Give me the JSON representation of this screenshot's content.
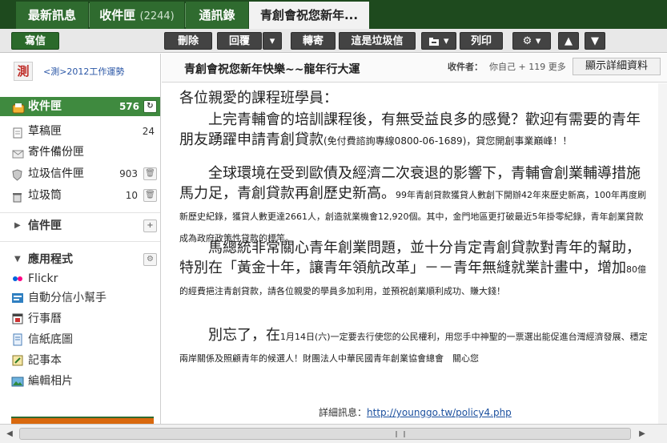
{
  "tabs": [
    {
      "label": "最新訊息"
    },
    {
      "label": "收件匣",
      "count": "(2244)"
    },
    {
      "label": "通訊錄"
    },
    {
      "label": "青創會祝您新年..."
    }
  ],
  "toolbar": {
    "compose": "寫信",
    "delete": "刪除",
    "reply": "回覆",
    "forward": "轉寄",
    "spam": "這是垃圾信",
    "print": "列印"
  },
  "profile": {
    "avatar_char": "測",
    "name": "<測>2012工作運勢"
  },
  "folders": [
    {
      "label": "收件匣",
      "count": "576",
      "icon": "inbox-icon"
    },
    {
      "label": "草稿匣",
      "count": "24",
      "icon": "draft-icon"
    },
    {
      "label": "寄件備份匣",
      "count": "",
      "icon": "sent-icon"
    },
    {
      "label": "垃圾信件匣",
      "count": "903",
      "icon": "spam-shield-icon"
    },
    {
      "label": "垃圾筒",
      "count": "10",
      "icon": "trash-icon"
    }
  ],
  "sections": {
    "mail_folders": "信件匣",
    "apps": "應用程式"
  },
  "apps": [
    {
      "label": "Flickr",
      "icon": "flickr-icon"
    },
    {
      "label": "自動分信小幫手",
      "icon": "auto-sort-icon"
    },
    {
      "label": "行事曆",
      "icon": "calendar-icon"
    },
    {
      "label": "信紙底圖",
      "icon": "stationery-icon"
    },
    {
      "label": "記事本",
      "icon": "notepad-icon"
    },
    {
      "label": "編輯相片",
      "icon": "photo-edit-icon"
    }
  ],
  "message": {
    "subject": "青創會祝您新年快樂~~龍年行大運",
    "recipient_label": "收件者：",
    "recipient_value": "你自己 + 119 更多",
    "show_details": "顯示詳細資料",
    "greeting": "各位親愛的課程班學員：",
    "p1_a": "上完青輔會的培訓課程後，有無受益良多的感覺？歡迎有需要的青年朋友踴躍申請青創貸款",
    "p1_b": "(免付費諮詢專線0800-06-1689)",
    "p1_c": "，貸您開創事業巔峰！！",
    "p2_a": "全球環境在受到歐債及經濟二次衰退的影響下，青輔會創業輔導措施馬力足，青創貸款再創歷史新高。",
    "p2_b": "99年青創貸款獲貸人數創下開辦42年來歷史新高，100年再度刷新歷史紀錄，獲貸人數更達2661人，創造就業機會12,920個。其中，金門地區更打破最近5年掛零紀錄，青年創業貸款成為政府政策性貸款的標竿。",
    "p3_a": "馬總統非常關心青年創業問題，並十分肯定青創貸款對青年的幫助，特別在「黃金十年，讓青年領航改革」－－青年無縫就業計畫中，增加",
    "p3_b": "80億的經費挹注青創貸款，請各位親愛的學員多加利用，並預祝創業順利成功、賺大錢！",
    "p4_a": "別忘了，在",
    "p4_b": "1月14日(六)一定要去行使您的公民權利，用您手中神聖的一票選出能促進台灣經濟發展、穩定兩岸關係及照顧青年的候選人！財團法人中華民國青年創業協會總會　關心您",
    "detail_label": "詳細訊息：",
    "detail_url": "http://younggo.tw/policy4.php"
  },
  "colors": {
    "tabbar": "#1e4a1e",
    "tab": "#2f6b2f",
    "active_folder": "#3f8a3f",
    "toolbar_button": "#434343",
    "link": "#1a4f9e"
  }
}
